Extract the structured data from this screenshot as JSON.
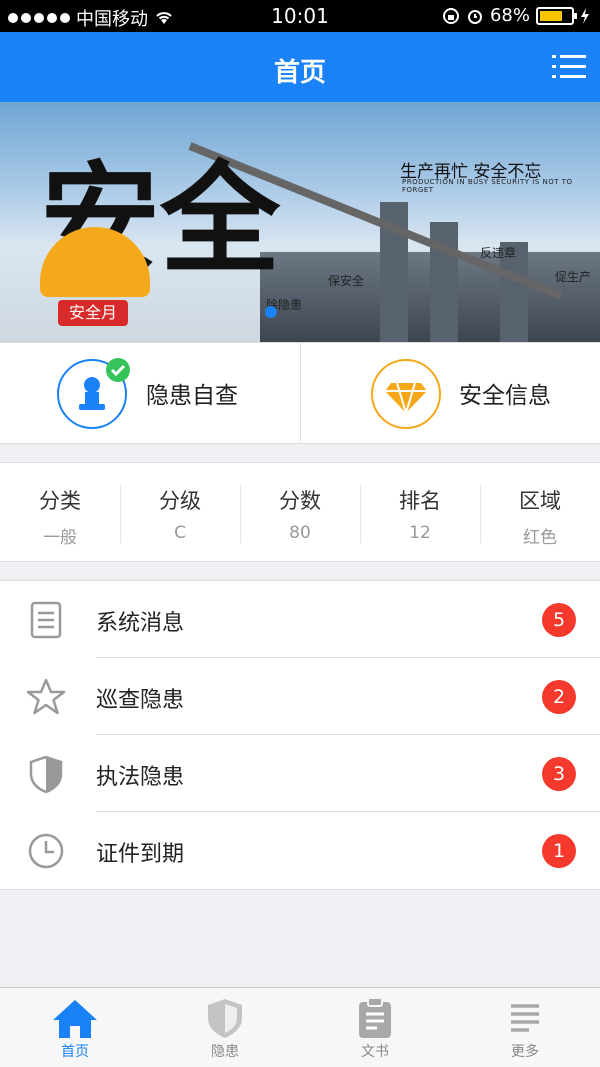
{
  "status_bar": {
    "carrier": "中国移动",
    "time": "10:01",
    "battery_percent": "68%"
  },
  "nav": {
    "title": "首页",
    "menu_icon": "list-menu-icon"
  },
  "banner": {
    "big_text": "安全",
    "slogan": "生产再忙 安全不忘",
    "slogan_en": "PRODUCTION IN BUSY  SECURITY IS NOT TO FORGET",
    "badge": "安全月",
    "tag1": "保安全",
    "tag2": "反违章",
    "tag3": "促生产",
    "tag4": "除隐患"
  },
  "quick_actions": [
    {
      "label": "隐患自查",
      "icon": "stamp-check-icon"
    },
    {
      "label": "安全信息",
      "icon": "diamond-icon"
    }
  ],
  "stats": [
    {
      "key": "分类",
      "value": "一般"
    },
    {
      "key": "分级",
      "value": "C"
    },
    {
      "key": "分数",
      "value": "80"
    },
    {
      "key": "排名",
      "value": "12"
    },
    {
      "key": "区域",
      "value": "红色"
    }
  ],
  "list": [
    {
      "label": "系统消息",
      "count": "5",
      "icon": "document-icon"
    },
    {
      "label": "巡查隐患",
      "count": "2",
      "icon": "star-icon"
    },
    {
      "label": "执法隐患",
      "count": "3",
      "icon": "shield-icon"
    },
    {
      "label": "证件到期",
      "count": "1",
      "icon": "clock-icon"
    }
  ],
  "tabbar": [
    {
      "label": "首页",
      "icon": "home-icon",
      "active": true
    },
    {
      "label": "隐患",
      "icon": "shield-icon"
    },
    {
      "label": "文书",
      "icon": "clipboard-icon"
    },
    {
      "label": "更多",
      "icon": "more-lines-icon"
    }
  ],
  "colors": {
    "primary": "#1a82f6",
    "badge_red": "#f53a2d"
  }
}
